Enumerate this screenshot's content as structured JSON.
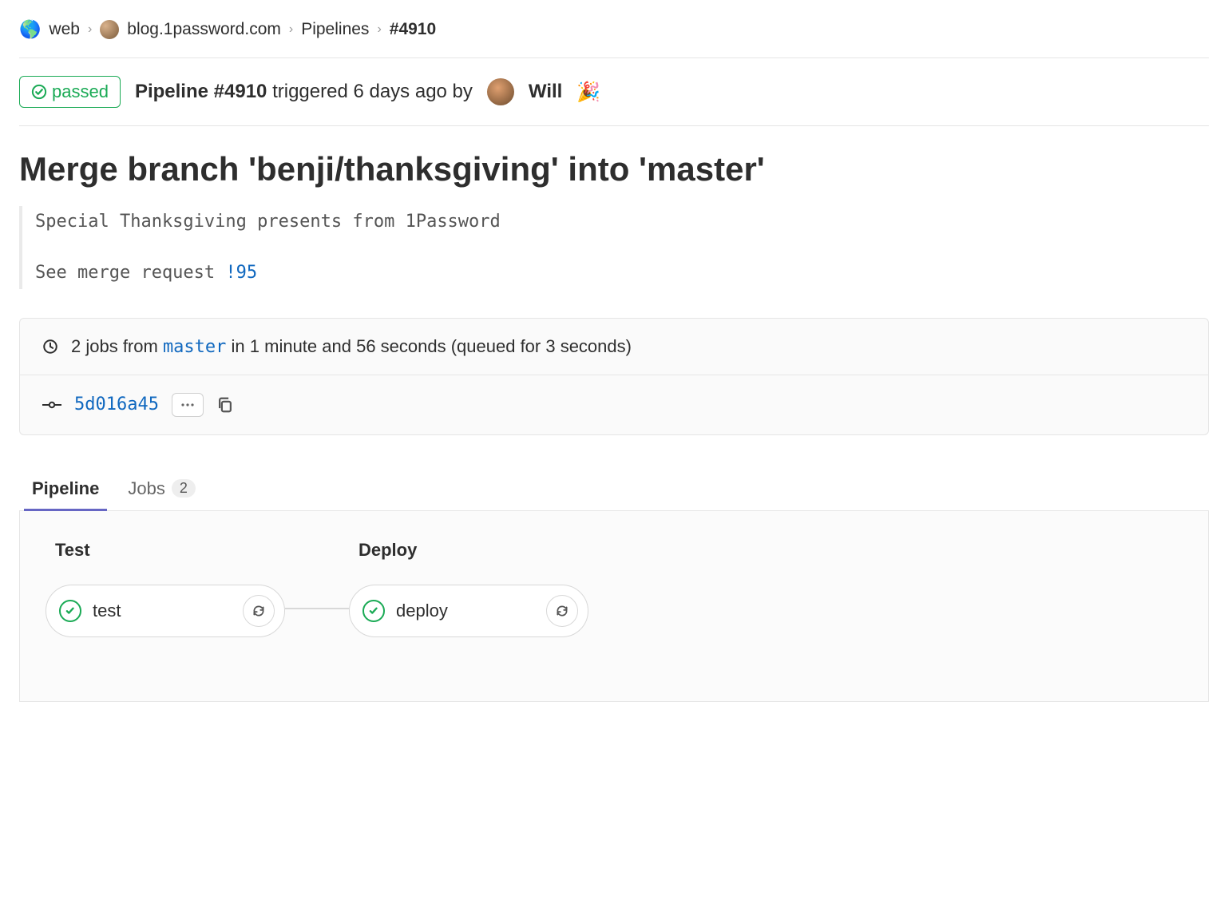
{
  "breadcrumbs": {
    "group": "web",
    "project": "blog.1password.com",
    "section": "Pipelines",
    "current": "#4910"
  },
  "status": {
    "label": "passed"
  },
  "header": {
    "prefix": "Pipeline",
    "id": "#4910",
    "triggered_text": "triggered 6 days ago by",
    "user": "Will",
    "user_emoji": "🎉"
  },
  "commit": {
    "title": "Merge branch 'benji/thanksgiving' into 'master'",
    "message_line1": "Special Thanksgiving presents from 1Password",
    "message_line2_prefix": "See merge request ",
    "merge_request": "!95"
  },
  "summary": {
    "jobs_prefix": "2 jobs from ",
    "branch": "master",
    "duration_text": " in 1 minute and 56 seconds (queued for 3 seconds)",
    "sha": "5d016a45"
  },
  "tabs": [
    {
      "label": "Pipeline",
      "active": true
    },
    {
      "label": "Jobs",
      "count": "2",
      "active": false
    }
  ],
  "stages": [
    {
      "name": "Test",
      "jobs": [
        {
          "name": "test",
          "status": "passed"
        }
      ]
    },
    {
      "name": "Deploy",
      "jobs": [
        {
          "name": "deploy",
          "status": "passed"
        }
      ]
    }
  ]
}
